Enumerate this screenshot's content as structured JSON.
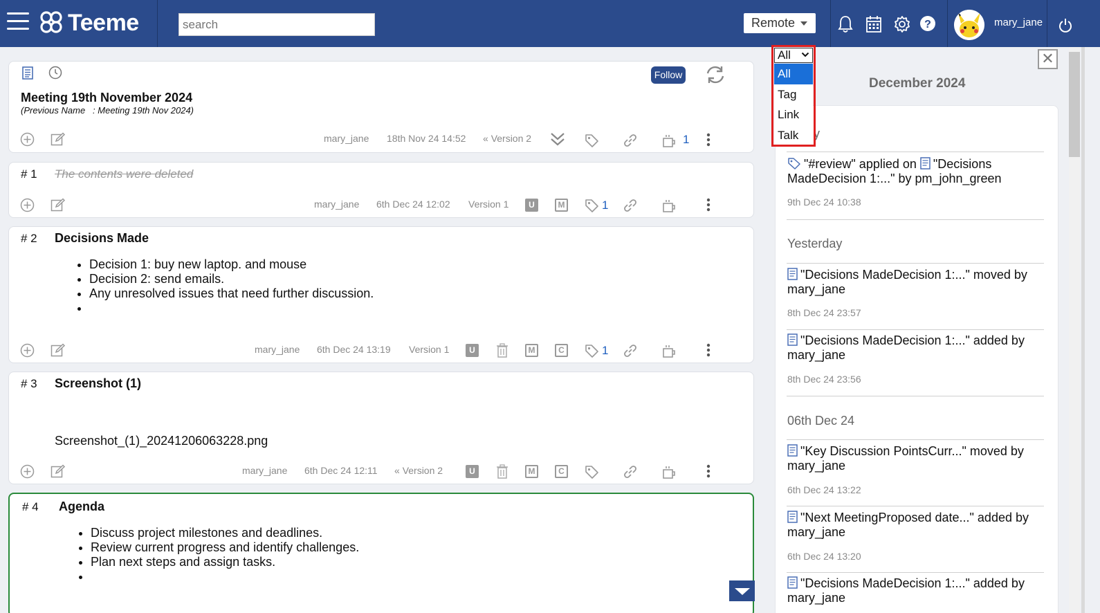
{
  "header": {
    "app_name": "Teeme",
    "search_placeholder": "search",
    "mode_label": "Remote",
    "username": "mary_jane"
  },
  "main_card": {
    "title": "Meeting 19th November 2024",
    "previous_name": "(Previous Name   : Meeting 19th Nov 2024)",
    "follow_label": "Follow",
    "author": "mary_jane",
    "date": "18th Nov 24 14:52",
    "version": "Version 2",
    "talk_count": "1"
  },
  "posts": [
    {
      "num": "# 1",
      "deleted_text": "The contents were deleted",
      "author": "mary_jane",
      "date": "6th Dec 24 12:02",
      "version": "Version 1",
      "tag_count": "1"
    },
    {
      "num": "# 2",
      "title": "Decisions Made",
      "bullets": [
        "Decision 1: buy new laptop. and mouse",
        "Decision 2: send emails.",
        "Any unresolved issues that need further discussion.",
        ""
      ],
      "author": "mary_jane",
      "date": "6th Dec 24 13:19",
      "version": "Version 1",
      "tag_count": "1"
    },
    {
      "num": "# 3",
      "title": "Screenshot (1)",
      "file": "Screenshot_(1)_20241206063228.png",
      "author": "mary_jane",
      "date": "6th Dec 24 12:11",
      "version": "Version 2"
    },
    {
      "num": "# 4",
      "title": "Agenda",
      "bullets": [
        "Discuss project milestones and deadlines.",
        "Review current progress and identify challenges.",
        "Plan next steps and assign tasks.",
        ""
      ]
    }
  ],
  "activity": {
    "month": "December 2024",
    "filter": {
      "selected": "All",
      "options": [
        "All",
        "Tag",
        "Link",
        "Talk"
      ]
    },
    "partial_day_fragment": "y",
    "items": [
      {
        "text": "\"#review\" applied on",
        "text2": "\"Decisions MadeDecision 1:...\" by pm_john_green",
        "time": "9th Dec 24 10:38"
      },
      {
        "text": "\"Decisions MadeDecision 1:...\" moved by mary_jane",
        "time": "8th Dec 24 23:57"
      },
      {
        "text": "\"Decisions MadeDecision 1:...\" added by mary_jane",
        "time": "8th Dec 24 23:56"
      },
      {
        "text": "\"Key Discussion PointsCurr...\" moved by mary_jane",
        "time": "6th Dec 24 13:22"
      },
      {
        "text": "\"Next MeetingProposed date...\" added by mary_jane",
        "time": "6th Dec 24 13:20"
      },
      {
        "text": "\"Decisions MadeDecision 1:...\" added by mary_jane",
        "time": ""
      }
    ],
    "day_labels": [
      "Yesterday",
      "06th Dec 24"
    ]
  },
  "colors": {
    "header_bg": "#2b4b8c",
    "accent_blue": "#1f5fbf",
    "active_border": "#2a8a3a",
    "highlight_red": "#e02020",
    "selected_option": "#1a6fd8"
  }
}
